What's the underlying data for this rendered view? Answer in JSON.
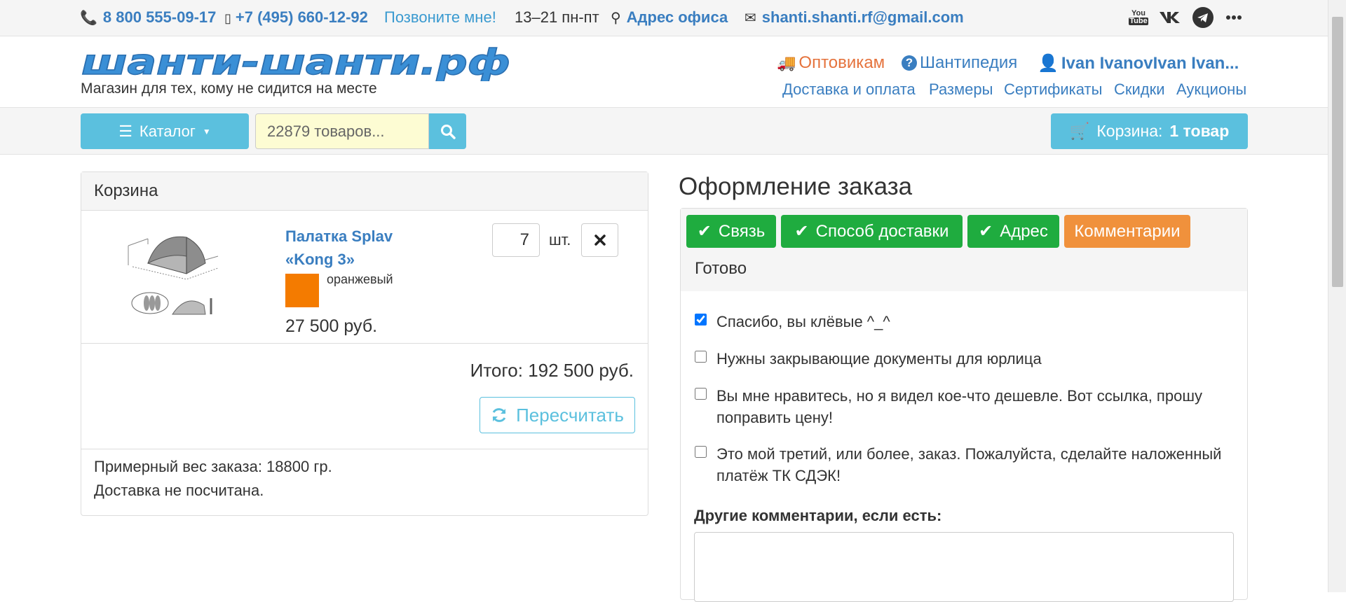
{
  "topbar": {
    "phone1": "8 800 555-09-17",
    "phone2": "+7 (495) 660-12-92",
    "callback": "Позвоните мне!",
    "hours": "13–21 пн-пт",
    "office": "Адрес офиса",
    "email": "shanti.shanti.rf@gmail.com",
    "social": {
      "youtube_top": "You",
      "youtube_bottom": "Tube"
    }
  },
  "header": {
    "logo": "шанти-шанти.рф",
    "tagline": "Магазин для тех, кому не сидится на месте",
    "wholesale": "Оптовикам",
    "wiki": "Шантипедия",
    "user": "Ivan IvanovIvan Ivan...",
    "links": [
      "Доставка и оплата",
      "Размеры",
      "Сертификаты",
      "Скидки",
      "Аукционы"
    ]
  },
  "search": {
    "catalog_label": "Каталог",
    "placeholder": "22879 товаров...",
    "cart_label": "Корзина:",
    "cart_count": "1 товар"
  },
  "cart": {
    "title": "Корзина",
    "item": {
      "name": "Палатка Splav «Kong 3»",
      "color_name": "оранжевый",
      "color": "#f47b00",
      "price": "27 500 руб.",
      "qty": "7",
      "unit": "шт."
    },
    "total": "Итого: 192 500 руб.",
    "recalc": "Пересчитать",
    "weight": "Примерный вес заказа: 18800 гр.",
    "delivery_note": "Доставка не посчитана."
  },
  "order": {
    "title": "Оформление заказа",
    "steps": [
      {
        "label": "Связь",
        "state": "done"
      },
      {
        "label": "Способ доставки",
        "state": "done"
      },
      {
        "label": "Адрес",
        "state": "done"
      },
      {
        "label": "Комментарии",
        "state": "active"
      }
    ],
    "ready": "Готово",
    "checks": [
      {
        "label": "Спасибо, вы клёвые ^_^",
        "checked": true
      },
      {
        "label": "Нужны закрывающие документы для юрлица",
        "checked": false
      },
      {
        "label": "Вы мне нравитесь, но я видел кое-что дешевле. Вот ссылка, прошу поправить цену!",
        "checked": false
      },
      {
        "label": "Это мой третий, или более, заказ. Пожалуйста, сделайте наложенный платёж ТК СДЭК!",
        "checked": false
      }
    ],
    "other_label": "Другие комментарии, если есть:",
    "other_value": ""
  },
  "colors": {
    "link": "#3a7ec0",
    "info": "#5bc0de",
    "success": "#1fac3f",
    "warning": "#f0913c"
  }
}
